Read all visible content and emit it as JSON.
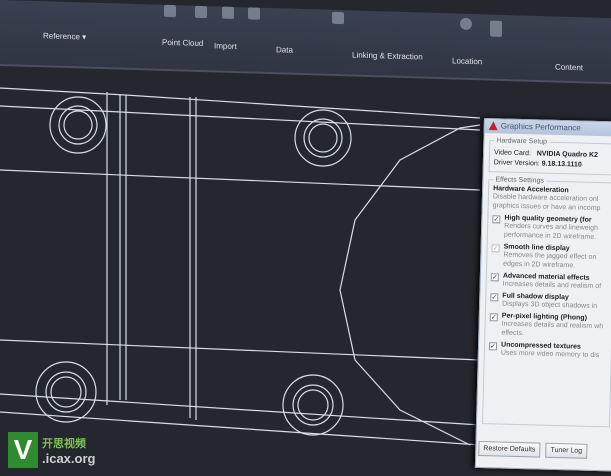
{
  "ribbon": {
    "groups": [
      "Reference",
      "Point Cloud",
      "Import",
      "Data",
      "Linking & Extraction",
      "Location",
      "Content"
    ]
  },
  "dialog": {
    "title": "Graphics Performance",
    "hardware_legend": "Hardware Setup",
    "video_card_label": "Video Card:",
    "video_card": "NVIDIA Quadro K2",
    "driver_label": "Driver Version:",
    "driver": "9.18.13.1110",
    "effects_legend": "Effects Settings",
    "hw_accel_title": "Hardware Acceleration",
    "hw_accel_desc": [
      "Disable hardware acceleration onl",
      "graphics issues or have an incomp"
    ],
    "options": [
      {
        "label": "High quality geometry (for",
        "desc": [
          "Renders curves and lineweigh",
          "performance in 2D wireframe."
        ],
        "checked": true,
        "enabled": true
      },
      {
        "label": "Smooth line display",
        "desc": [
          "Removes the jagged effect on",
          "edges in 2D wireframe."
        ],
        "checked": true,
        "enabled": false
      },
      {
        "label": "Advanced material effects",
        "desc": [
          "Increases details and realism of"
        ],
        "checked": true,
        "enabled": true
      },
      {
        "label": "Full shadow display",
        "desc": [
          "Displays 3D object shadows in"
        ],
        "checked": true,
        "enabled": true
      },
      {
        "label": "Per-pixel lighting (Phong)",
        "desc": [
          "Increases details and realism wh",
          "effects."
        ],
        "checked": true,
        "enabled": true
      },
      {
        "label": "Uncompressed textures",
        "desc": [
          "Uses more video memory to dis"
        ],
        "checked": true,
        "enabled": true
      }
    ],
    "restore_button": "Restore Defaults",
    "tuner_button": "Tuner Log"
  },
  "watermark": {
    "line1": "开思视频",
    "line2": ".icax.org",
    "logo": "V"
  }
}
